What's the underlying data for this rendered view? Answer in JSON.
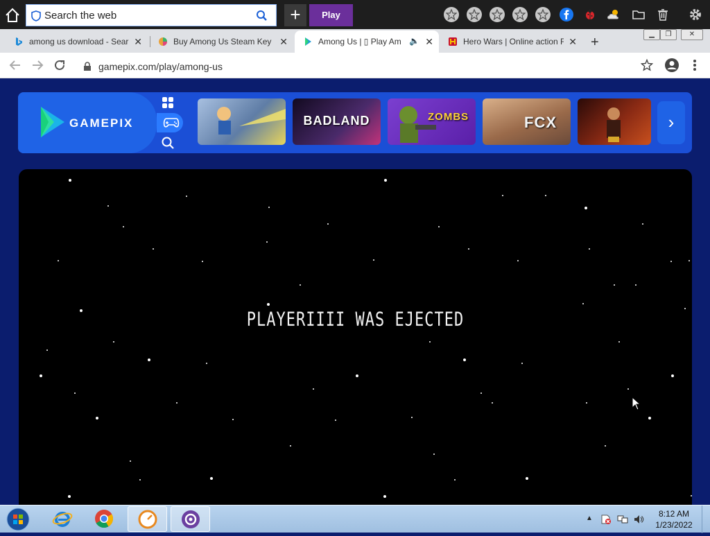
{
  "toolbar": {
    "search_placeholder": "Search the web",
    "play_label": "Play",
    "plus_label": "+"
  },
  "tabs": [
    {
      "title": "among us download - Sear",
      "favicon": "bing-icon"
    },
    {
      "title": "Buy Among Us Steam Key |",
      "favicon": "colorful-icon"
    },
    {
      "title": "Among Us | ▯ Play Am",
      "favicon": "gamepix-icon",
      "active": true,
      "audio": true
    },
    {
      "title": "Hero Wars | Online action F",
      "favicon": "hero-wars-icon"
    }
  ],
  "address": {
    "url": "gamepix.com/play/among-us"
  },
  "gamepix": {
    "logo_text": "GAMEPIX",
    "games": [
      {
        "label": "",
        "name": "jetpack-joyride",
        "color": "#7a8ea8"
      },
      {
        "label": "BADLAND",
        "name": "badland",
        "color": "#2a1a3d"
      },
      {
        "label": "ZOMBS",
        "name": "zombs-royale",
        "color": "#6a2fb8"
      },
      {
        "label": "FCX",
        "name": "fcx",
        "color": "#a86a4a"
      },
      {
        "label": "",
        "name": "kult",
        "color": "#6a1a10"
      }
    ]
  },
  "game": {
    "message": "PLAYERIIII WAS EJECTED"
  },
  "taskbar": {
    "time": "8:12 AM",
    "date": "1/23/2022"
  },
  "colors": {
    "page_bg": "#0b1d6e",
    "gamepix_blue": "#1b4fd6",
    "play_purple": "#6b2f9b"
  }
}
